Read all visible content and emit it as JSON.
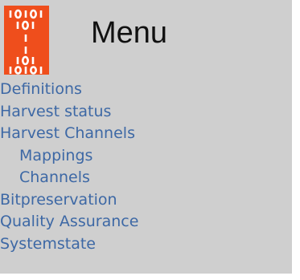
{
  "menu": {
    "title": "Menu",
    "logo_icon": "binary-digits-logo",
    "logo_color": "#ef4e1c",
    "link_color": "#3d68a5",
    "background_color": "#cfcfcf",
    "items": [
      {
        "label": "Definitions",
        "level": 0
      },
      {
        "label": "Harvest status",
        "level": 0
      },
      {
        "label": "Harvest Channels",
        "level": 0
      },
      {
        "label": "Mappings",
        "level": 1
      },
      {
        "label": "Channels",
        "level": 1
      },
      {
        "label": "Bitpreservation",
        "level": 0
      },
      {
        "label": "Quality Assurance",
        "level": 0
      },
      {
        "label": "Systemstate",
        "level": 0
      }
    ]
  }
}
